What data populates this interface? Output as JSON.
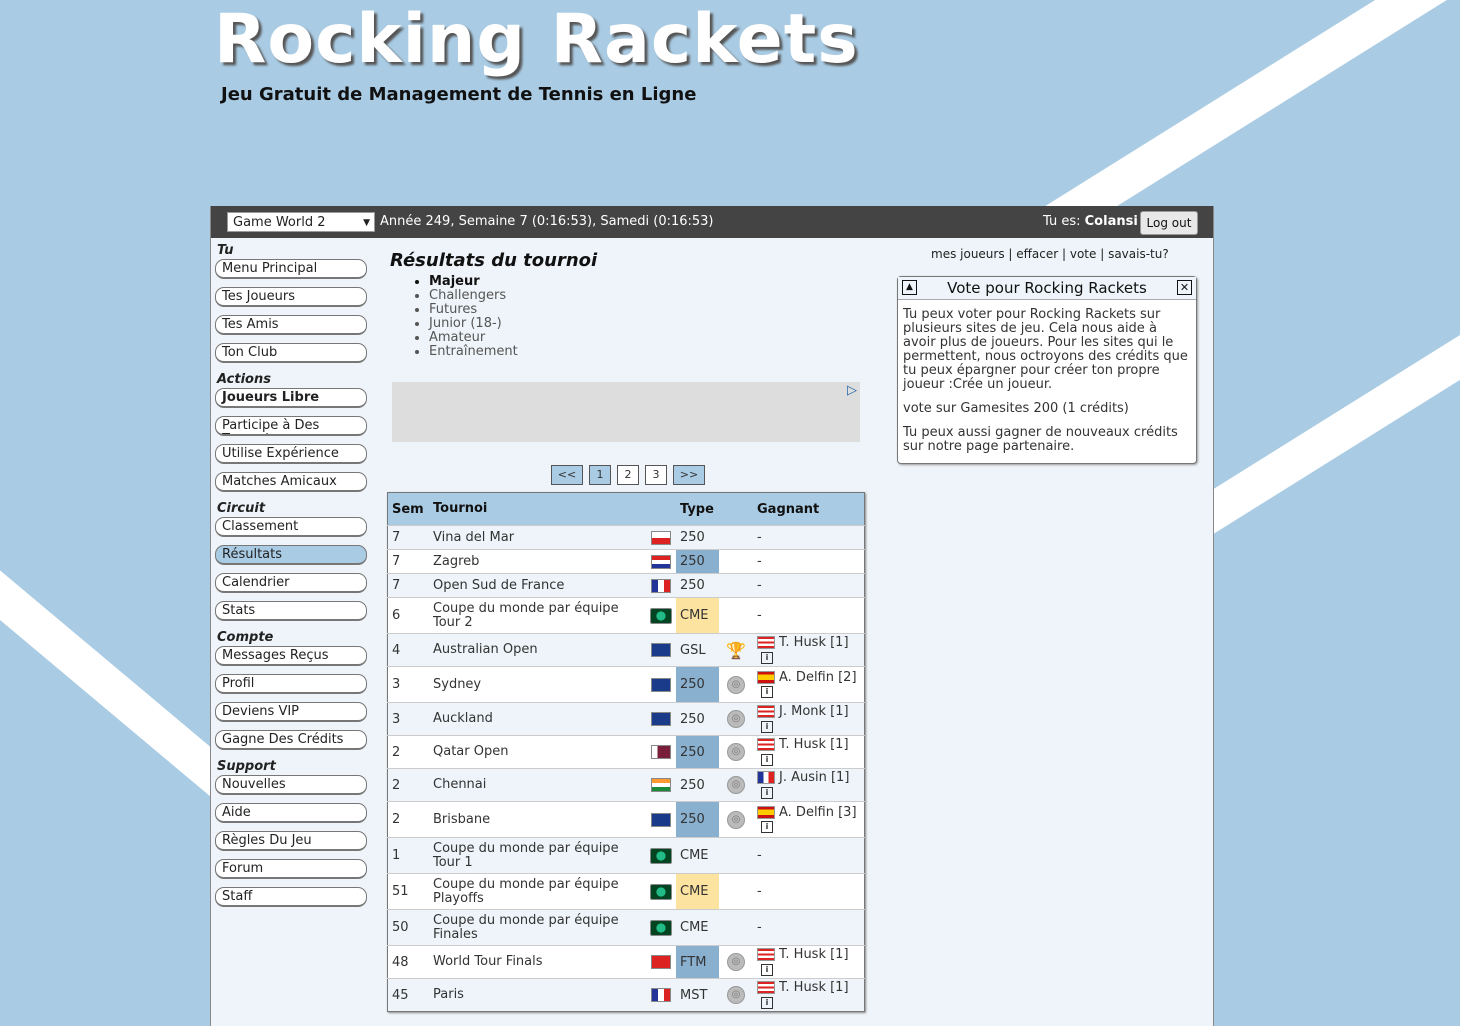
{
  "site": {
    "title": "Rocking Rackets",
    "tagline": "Jeu Gratuit de Management de Tennis en Ligne"
  },
  "topbar": {
    "game_world": "Game World 2",
    "date": "Année 249, Semaine 7 (0:16:53), Samedi (0:16:53)",
    "you_are_label": "Tu es:",
    "username": "Colansi",
    "logout": "Log out"
  },
  "sidebar": {
    "sections": [
      {
        "title": "Tu",
        "items": [
          "Menu Principal",
          "Tes Joueurs",
          "Tes Amis",
          "Ton Club"
        ]
      },
      {
        "title": "Actions",
        "items": [
          "Joueurs Libre",
          "Participe à Des Tournois",
          "Utilise Expérience",
          "Matches Amicaux"
        ]
      },
      {
        "title": "Circuit",
        "items": [
          "Classement",
          "Résultats",
          "Calendrier",
          "Stats"
        ]
      },
      {
        "title": "Compte",
        "items": [
          "Messages Reçus",
          "Profil",
          "Deviens VIP",
          "Gagne Des Crédits"
        ]
      },
      {
        "title": "Support",
        "items": [
          "Nouvelles",
          "Aide",
          "Règles Du Jeu",
          "Forum",
          "Staff"
        ]
      }
    ]
  },
  "main": {
    "title": "Résultats du tournoi",
    "categories": [
      "Majeur",
      "Challengers",
      "Futures",
      "Junior (18-)",
      "Amateur",
      "Entraînement"
    ],
    "pager": [
      "<<",
      "1",
      "2",
      "3",
      ">>"
    ],
    "table": {
      "headers": {
        "sem": "Sem",
        "tournoi": "Tournoi",
        "type": "Type",
        "gagnant": "Gagnant"
      },
      "rows": [
        {
          "sem": "7",
          "name": "Vina del Mar",
          "type": "250",
          "winner": "-"
        },
        {
          "sem": "7",
          "name": "Zagreb",
          "type": "250",
          "winner": "-"
        },
        {
          "sem": "7",
          "name": "Open Sud de France",
          "type": "250",
          "winner": "-"
        },
        {
          "sem": "6",
          "name": "Coupe du monde par équipe Tour 2",
          "type": "CME",
          "winner": "-"
        },
        {
          "sem": "4",
          "name": "Australian Open",
          "type": "GSL",
          "winner": "T. Husk [1]"
        },
        {
          "sem": "3",
          "name": "Sydney",
          "type": "250",
          "winner": "A. Delfin [2]"
        },
        {
          "sem": "3",
          "name": "Auckland",
          "type": "250",
          "winner": "J. Monk [1]"
        },
        {
          "sem": "2",
          "name": "Qatar Open",
          "type": "250",
          "winner": "T. Husk [1]"
        },
        {
          "sem": "2",
          "name": "Chennai",
          "type": "250",
          "winner": "J. Ausin [1]"
        },
        {
          "sem": "2",
          "name": "Brisbane",
          "type": "250",
          "winner": "A. Delfin [3]"
        },
        {
          "sem": "1",
          "name": "Coupe du monde par équipe Tour 1",
          "type": "CME",
          "winner": "-"
        },
        {
          "sem": "51",
          "name": "Coupe du monde par équipe Playoffs",
          "type": "CME",
          "winner": "-"
        },
        {
          "sem": "50",
          "name": "Coupe du monde par équipe Finales",
          "type": "CME",
          "winner": "-"
        },
        {
          "sem": "48",
          "name": "World Tour Finals",
          "type": "FTM",
          "winner": "T. Husk [1]"
        },
        {
          "sem": "45",
          "name": "Paris",
          "type": "MST",
          "winner": "T. Husk [1]"
        }
      ]
    }
  },
  "right": {
    "links": [
      "mes joueurs",
      "effacer",
      "vote",
      "savais-tu?"
    ],
    "vote_box": {
      "title": "Vote pour Rocking Rackets",
      "p1": "Tu peux voter pour Rocking Rackets sur plusieurs sites de jeu. Cela nous aide à avoir plus de joueurs. Pour les sites qui le permettent, nous octroyons des crédits que tu peux épargner pour créer ton propre joueur :Crée un joueur.",
      "p2": "vote sur Gamesites 200 (1 crédits)",
      "p3": "Tu peux aussi gagner de nouveaux crédits sur notre page partenaire."
    }
  },
  "colors": {
    "background": "#a9cbe3",
    "topbar": "#444444",
    "type_250_highlight": "#e07a5f",
    "type_cme": "#fde3a0"
  }
}
